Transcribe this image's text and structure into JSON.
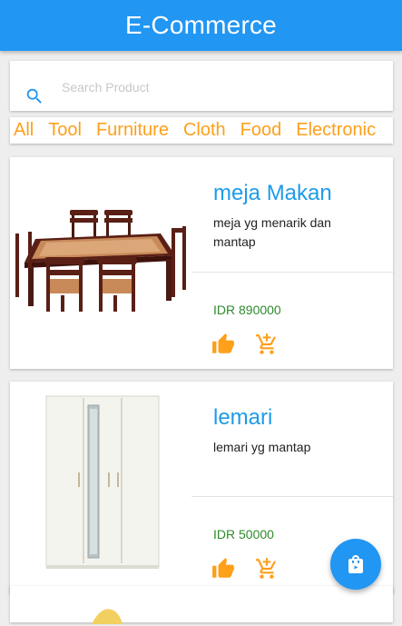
{
  "app": {
    "title": "E-Commerce",
    "colors": {
      "primary": "#2196f3",
      "accent": "#ff9f1a",
      "price": "#2e8b2e",
      "title": "#1e9be9"
    }
  },
  "search": {
    "placeholder": "Search Product",
    "value": "",
    "icon": "search-icon"
  },
  "categories": [
    "All",
    "Tool",
    "Furniture",
    "Cloth",
    "Food",
    "Electronic"
  ],
  "products": [
    {
      "name": "meja Makan",
      "description": "meja yg menarik dan mantap",
      "price": "IDR 890000",
      "image": "dining-table-image",
      "actions": [
        "thumb-up-icon",
        "add-shopping-cart-icon"
      ]
    },
    {
      "name": "lemari",
      "description": "lemari yg mantap",
      "price": "IDR 50000",
      "image": "wardrobe-image",
      "actions": [
        "thumb-up-icon",
        "add-shopping-cart-icon"
      ]
    }
  ],
  "fab": {
    "icon": "shopping-bag-icon"
  }
}
